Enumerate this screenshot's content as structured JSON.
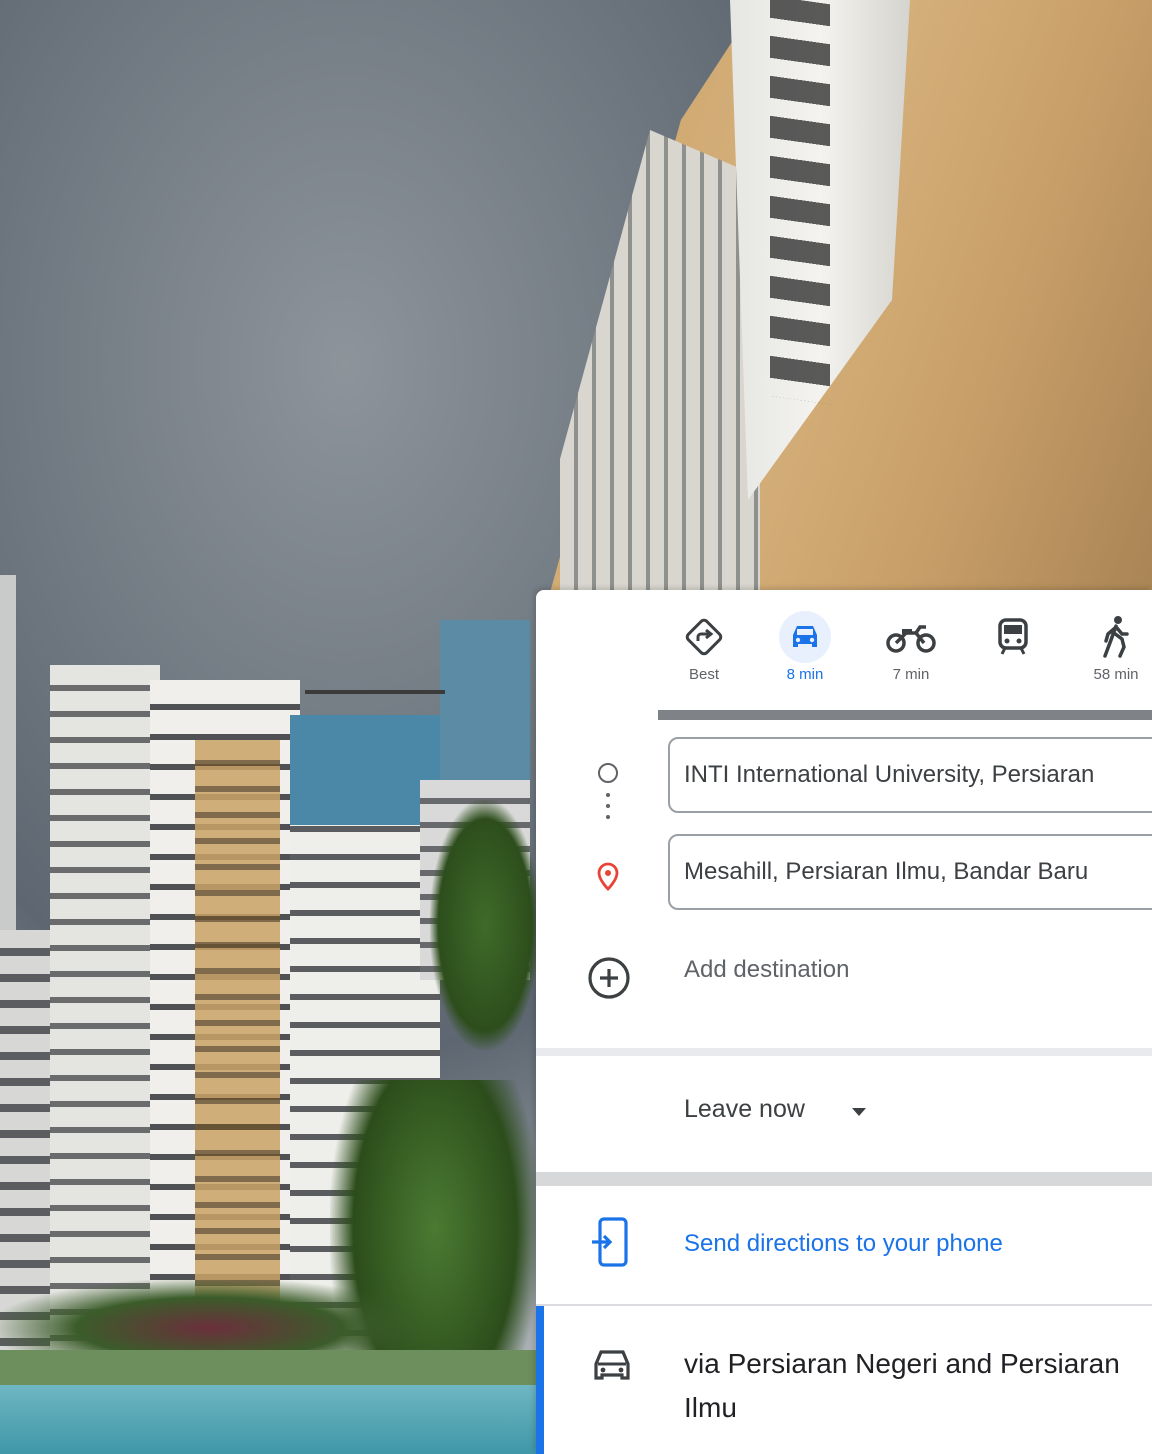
{
  "directions": {
    "modes": [
      {
        "name": "best",
        "label": "Best"
      },
      {
        "name": "driving",
        "label": "8 min"
      },
      {
        "name": "motorcycle",
        "label": "7 min"
      },
      {
        "name": "transit",
        "label": ""
      },
      {
        "name": "walking",
        "label": "58 min"
      }
    ],
    "selected_mode": "driving",
    "origin": "INTI International University, Persiaran",
    "destination": "Mesahill, Persiaran Ilmu, Bandar Baru",
    "add_destination": "Add destination",
    "leave_now": "Leave now",
    "send_to_phone": "Send directions to your phone",
    "route_summary": "via Persiaran Negeri and Persiaran Ilmu"
  },
  "colors": {
    "accent": "#1a73e8",
    "destination_pin": "#ea4335"
  },
  "icons": {
    "best": "diamond-arrow-icon",
    "driving": "car-icon",
    "motorcycle": "motorcycle-icon",
    "transit": "train-icon",
    "walking": "walking-person-icon",
    "origin": "circle-outline-icon",
    "destination": "location-pin-icon",
    "add": "plus-circle-icon",
    "phone": "send-to-phone-icon",
    "route": "car-icon"
  }
}
